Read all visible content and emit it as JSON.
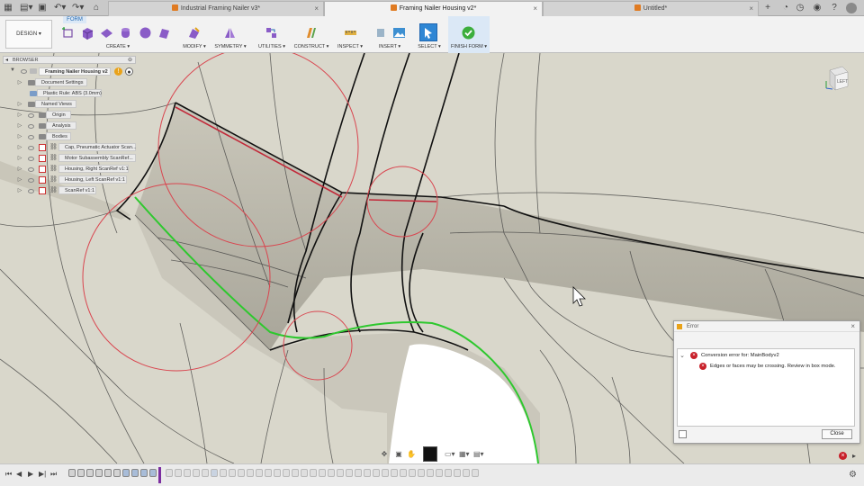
{
  "tabs": [
    {
      "title": "Industrial Framing Nailer v3*"
    },
    {
      "title": "Framing Nailer Housing v2*"
    },
    {
      "title": "Untitled*"
    }
  ],
  "toolbar": {
    "workspace": "DESIGN ▾",
    "form_tab": "FORM",
    "groups": [
      "CREATE ▾",
      "MODIFY ▾",
      "SYMMETRY ▾",
      "UTILITIES ▾",
      "CONSTRUCT ▾",
      "INSPECT ▾",
      "INSERT ▾",
      "SELECT ▾",
      "FINISH FORM ▾"
    ]
  },
  "browser": {
    "header": "BROWSER",
    "root": "Framing Nailer Housing v2",
    "items": [
      "Document Settings",
      "Plastic Rule: ABS (3.0mm)",
      "Named Views",
      "Origin",
      "Analysis",
      "Bodies",
      "Cap, Pneumatic Actuator Scan...",
      "Motor Subassembly ScanRef...",
      "Housing, Right ScanRef v1:1",
      "Housing, Left ScanRef v1:1",
      "ScanRef v1:1"
    ]
  },
  "viewcube": {
    "face": "LEFT"
  },
  "error_dialog": {
    "title": "Error",
    "heading": "Conversion error for: MainBodyv2",
    "message": "Edges or faces may be crossing. Review in box mode.",
    "close_label": "Close"
  },
  "icons": {
    "tab_close": "×",
    "new_tab": "+",
    "caret_right": "▷",
    "caret_down": "▼"
  },
  "colors": {
    "accent": "#1f66b0",
    "error": "#c8202a",
    "highlight_edge": "#2ec82e",
    "selection_circle": "#d9454f",
    "surface": "#d9d7cb"
  }
}
